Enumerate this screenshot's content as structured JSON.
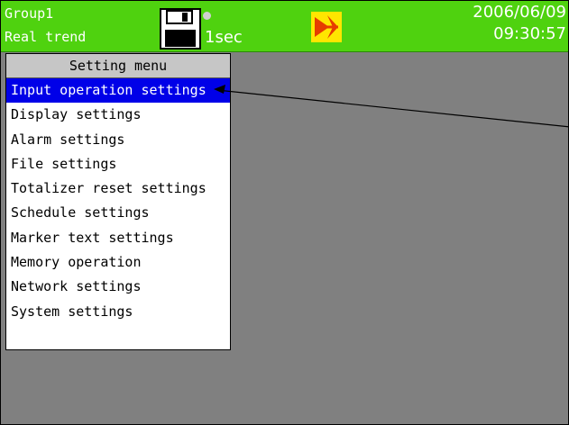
{
  "status_bar": {
    "group": "Group1",
    "screen": "Real trend",
    "interval": "1sec",
    "date": "2006/06/09",
    "time": "09:30:57",
    "background_color": "#4fd20f",
    "icons": [
      "floppy-disk-icon",
      "status-dot-icon",
      "alarm-warning-icon"
    ]
  },
  "menu": {
    "title": "Setting menu",
    "selected_index": 0,
    "selected_color": "#0000e8",
    "items": [
      {
        "label": "Input operation settings"
      },
      {
        "label": "Display settings"
      },
      {
        "label": "Alarm settings"
      },
      {
        "label": "File settings"
      },
      {
        "label": "Totalizer reset settings"
      },
      {
        "label": "Schedule settings"
      },
      {
        "label": "Marker text settings"
      },
      {
        "label": "Memory operation"
      },
      {
        "label": "Network settings"
      },
      {
        "label": "System settings"
      }
    ]
  }
}
